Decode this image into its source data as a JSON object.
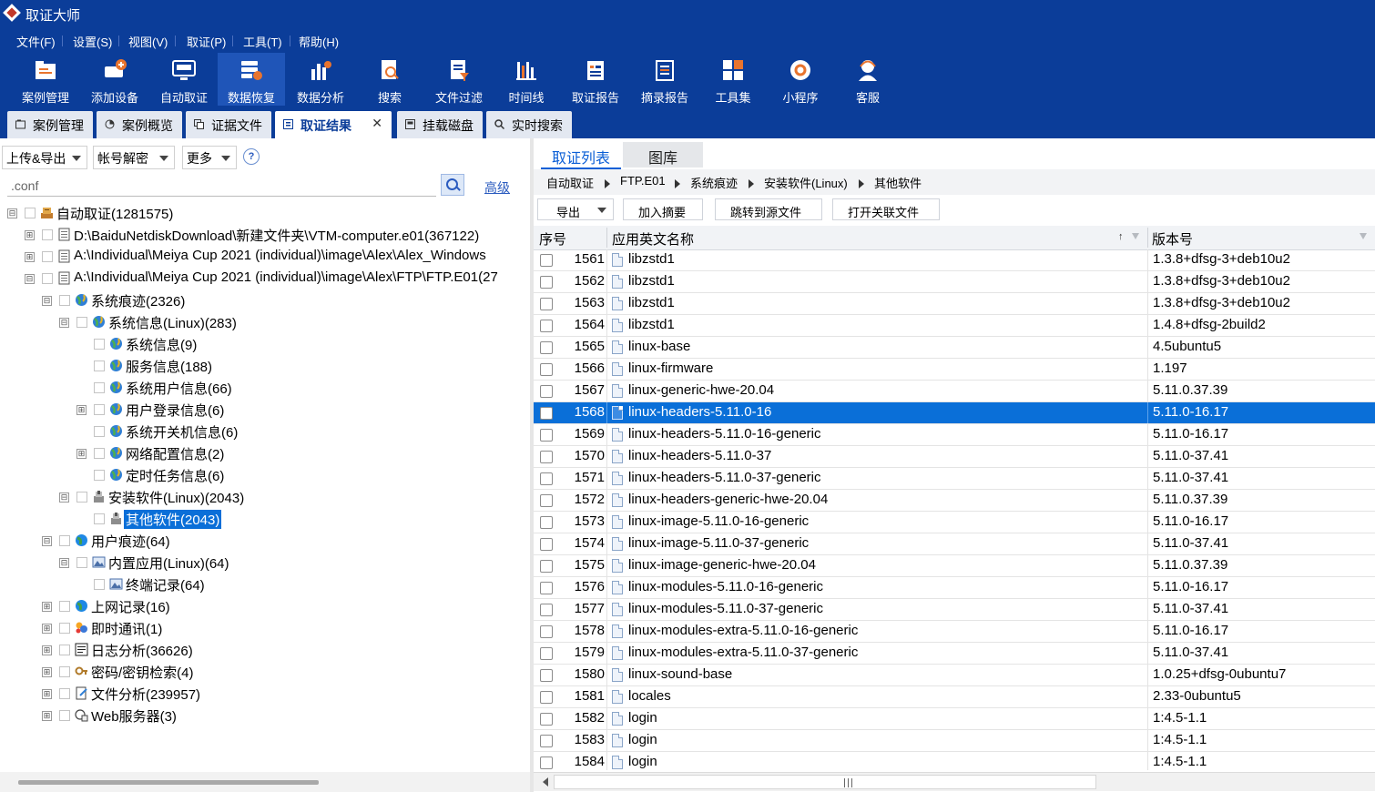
{
  "app": {
    "title": "取证大师"
  },
  "menu": [
    "文件(F)",
    "设置(S)",
    "视图(V)",
    "取证(P)",
    "工具(T)",
    "帮助(H)"
  ],
  "toolbar": [
    {
      "label": "案例管理",
      "icon": "case-management-icon"
    },
    {
      "label": "添加设备",
      "icon": "add-device-icon"
    },
    {
      "label": "自动取证",
      "icon": "auto-forensics-icon"
    },
    {
      "label": "数据恢复",
      "icon": "data-recovery-icon",
      "active": true
    },
    {
      "label": "数据分析",
      "icon": "data-analysis-icon"
    },
    {
      "label": "搜索",
      "icon": "search-doc-icon"
    },
    {
      "label": "文件过滤",
      "icon": "file-filter-icon"
    },
    {
      "label": "时间线",
      "icon": "timeline-icon"
    },
    {
      "label": "取证报告",
      "icon": "forensic-report-icon"
    },
    {
      "label": "摘录报告",
      "icon": "excerpt-report-icon"
    },
    {
      "label": "工具集",
      "icon": "toolkit-icon"
    },
    {
      "label": "小程序",
      "icon": "mini-program-icon"
    },
    {
      "label": "客服",
      "icon": "customer-service-icon"
    }
  ],
  "doc_tabs": [
    {
      "label": "案例管理"
    },
    {
      "label": "案例概览"
    },
    {
      "label": "证据文件"
    },
    {
      "label": "取证结果",
      "active": true,
      "close": "✕"
    },
    {
      "label": "挂载磁盘"
    },
    {
      "label": "实时搜索"
    }
  ],
  "left": {
    "upload_export": "上传&导出",
    "account_decrypt": "帐号解密",
    "more": "更多",
    "help": "?",
    "search_value": ".conf",
    "advanced": "高级",
    "tree": [
      {
        "label": "自动取证(1281575)",
        "expander": "⊟"
      },
      {
        "label": "D:\\BaiduNetdiskDownload\\新建文件夹\\VTM-computer.e01(367122)",
        "expander": "⊞"
      },
      {
        "label": "A:\\Individual\\Meiya Cup 2021 (individual)\\image\\Alex\\Alex_Windows",
        "expander": "⊞"
      },
      {
        "label": "A:\\Individual\\Meiya Cup 2021 (individual)\\image\\Alex\\FTP\\FTP.E01(27",
        "expander": "⊟"
      },
      {
        "label": "系统痕迹(2326)",
        "expander": "⊟"
      },
      {
        "label": "系统信息(Linux)(283)",
        "expander": "⊟"
      },
      {
        "label": "系统信息(9)",
        "expander": ""
      },
      {
        "label": "服务信息(188)",
        "expander": ""
      },
      {
        "label": "系统用户信息(66)",
        "expander": ""
      },
      {
        "label": "用户登录信息(6)",
        "expander": "⊞"
      },
      {
        "label": "系统开关机信息(6)",
        "expander": ""
      },
      {
        "label": "网络配置信息(2)",
        "expander": "⊞"
      },
      {
        "label": "定时任务信息(6)",
        "expander": ""
      },
      {
        "label": "安装软件(Linux)(2043)",
        "expander": "⊟"
      },
      {
        "label": "其他软件(2043)",
        "expander": ""
      },
      {
        "label": "用户痕迹(64)",
        "expander": "⊟"
      },
      {
        "label": "内置应用(Linux)(64)",
        "expander": "⊟"
      },
      {
        "label": "终端记录(64)",
        "expander": ""
      },
      {
        "label": "上网记录(16)",
        "expander": "⊞"
      },
      {
        "label": "即时通讯(1)",
        "expander": "⊞"
      },
      {
        "label": "日志分析(36626)",
        "expander": "⊞"
      },
      {
        "label": "密码/密钥检索(4)",
        "expander": "⊞"
      },
      {
        "label": "文件分析(239957)",
        "expander": "⊞"
      },
      {
        "label": "Web服务器(3)",
        "expander": "⊞"
      }
    ]
  },
  "right": {
    "tabs": [
      "取证列表",
      "图库"
    ],
    "breadcrumb": [
      "自动取证",
      "FTP.E01",
      "系统痕迹",
      "安装软件(Linux)",
      "其他软件"
    ],
    "actions": {
      "export": "导出",
      "add_excerpt": "加入摘要",
      "jump_source": "跳转到源文件",
      "open_related": "打开关联文件"
    },
    "columns": {
      "index": "序号",
      "name": "应用英文名称",
      "version": "版本号",
      "sort": "↑"
    },
    "selected_row": "1568",
    "rows": [
      {
        "n": "1561",
        "name": "libzstd1",
        "ver": "1.3.8+dfsg-3+deb10u2"
      },
      {
        "n": "1562",
        "name": "libzstd1",
        "ver": "1.3.8+dfsg-3+deb10u2"
      },
      {
        "n": "1563",
        "name": "libzstd1",
        "ver": "1.3.8+dfsg-3+deb10u2"
      },
      {
        "n": "1564",
        "name": "libzstd1",
        "ver": "1.4.8+dfsg-2build2"
      },
      {
        "n": "1565",
        "name": "linux-base",
        "ver": "4.5ubuntu5"
      },
      {
        "n": "1566",
        "name": "linux-firmware",
        "ver": "1.197"
      },
      {
        "n": "1567",
        "name": "linux-generic-hwe-20.04",
        "ver": "5.11.0.37.39"
      },
      {
        "n": "1568",
        "name": "linux-headers-5.11.0-16",
        "ver": "5.11.0-16.17"
      },
      {
        "n": "1569",
        "name": "linux-headers-5.11.0-16-generic",
        "ver": "5.11.0-16.17"
      },
      {
        "n": "1570",
        "name": "linux-headers-5.11.0-37",
        "ver": "5.11.0-37.41"
      },
      {
        "n": "1571",
        "name": "linux-headers-5.11.0-37-generic",
        "ver": "5.11.0-37.41"
      },
      {
        "n": "1572",
        "name": "linux-headers-generic-hwe-20.04",
        "ver": "5.11.0.37.39"
      },
      {
        "n": "1573",
        "name": "linux-image-5.11.0-16-generic",
        "ver": "5.11.0-16.17"
      },
      {
        "n": "1574",
        "name": "linux-image-5.11.0-37-generic",
        "ver": "5.11.0-37.41"
      },
      {
        "n": "1575",
        "name": "linux-image-generic-hwe-20.04",
        "ver": "5.11.0.37.39"
      },
      {
        "n": "1576",
        "name": "linux-modules-5.11.0-16-generic",
        "ver": "5.11.0-16.17"
      },
      {
        "n": "1577",
        "name": "linux-modules-5.11.0-37-generic",
        "ver": "5.11.0-37.41"
      },
      {
        "n": "1578",
        "name": "linux-modules-extra-5.11.0-16-generic",
        "ver": "5.11.0-16.17"
      },
      {
        "n": "1579",
        "name": "linux-modules-extra-5.11.0-37-generic",
        "ver": "5.11.0-37.41"
      },
      {
        "n": "1580",
        "name": "linux-sound-base",
        "ver": "1.0.25+dfsg-0ubuntu7"
      },
      {
        "n": "1581",
        "name": "locales",
        "ver": "2.33-0ubuntu5"
      },
      {
        "n": "1582",
        "name": "login",
        "ver": "1:4.5-1.1"
      },
      {
        "n": "1583",
        "name": "login",
        "ver": "1:4.5-1.1"
      },
      {
        "n": "1584",
        "name": "login",
        "ver": "1:4.5-1.1"
      }
    ]
  },
  "colors": {
    "brand": "#0b3d99",
    "selection": "#0a6fd8",
    "accent": "#0b5fd6"
  }
}
